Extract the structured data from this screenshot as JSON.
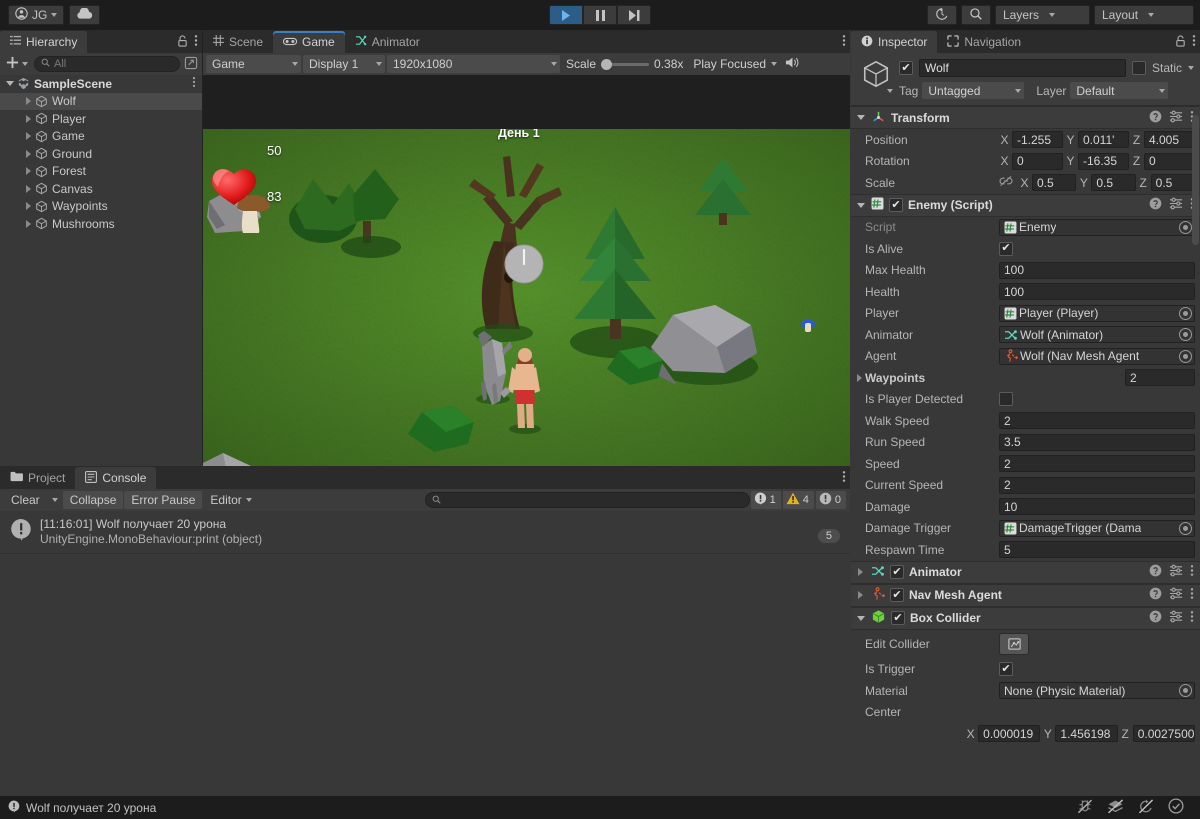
{
  "toolbar": {
    "account_label": "JG",
    "account_icon": "user-circle-icon",
    "cloud_icon": "cloud-icon",
    "play_icon": "play-icon",
    "pause_icon": "pause-icon",
    "step_icon": "step-icon",
    "history_icon": "undo-history-icon",
    "search_icon": "search-icon",
    "layers_label": "Layers",
    "layout_label": "Layout"
  },
  "hierarchy": {
    "tab_label": "Hierarchy",
    "tab_icon": "hierarchy-icon",
    "lock_icon": "lock-icon",
    "menu_icon": "kebab-menu-icon",
    "add_label": "+",
    "search_placeholder": "All",
    "search_icon": "search-icon",
    "filter_icon": "scene-filter-icon",
    "scene_name": "SampleScene",
    "items": [
      {
        "label": "Wolf",
        "selected": true
      },
      {
        "label": "Player",
        "selected": false
      },
      {
        "label": "Game",
        "selected": false
      },
      {
        "label": "Ground",
        "selected": false
      },
      {
        "label": "Forest",
        "selected": false
      },
      {
        "label": "Canvas",
        "selected": false
      },
      {
        "label": "Waypoints",
        "selected": false
      },
      {
        "label": "Mushrooms",
        "selected": false
      }
    ]
  },
  "gameview": {
    "tabs": [
      {
        "label": "Scene",
        "icon": "grid-icon",
        "active": false
      },
      {
        "label": "Game",
        "icon": "gamepad-icon",
        "active": true
      },
      {
        "label": "Animator",
        "icon": "animator-icon",
        "active": false
      }
    ],
    "menu_icon": "kebab-menu-icon",
    "target_label": "Game",
    "display_label": "Display 1",
    "resolution_label": "1920x1080",
    "scale_label": "Scale",
    "scale_value": "0.38x",
    "play_mode_label": "Play Focused",
    "mute_icon": "mute-audio-icon",
    "hud": {
      "health_icon": "heart-icon",
      "health_value": "50",
      "mushroom_icon": "mushroom-icon",
      "mushroom_value": "83",
      "day_label": "День 1",
      "clock_icon": "clock-icon"
    }
  },
  "inspector": {
    "tabs": [
      {
        "label": "Inspector",
        "icon": "info-icon",
        "active": true
      },
      {
        "label": "Navigation",
        "icon": "navigation-icon",
        "active": false
      }
    ],
    "lock_icon": "lock-icon",
    "menu_icon": "kebab-menu-icon",
    "object_icon": "gameobject-cube-icon",
    "enabled": true,
    "object_name": "Wolf",
    "static_label": "Static",
    "tag_label": "Tag",
    "tag_value": "Untagged",
    "layer_label": "Layer",
    "layer_value": "Default",
    "components": [
      {
        "name": "Transform",
        "icon": "transform-axis-icon",
        "expanded": true,
        "has_checkbox": false,
        "rows": [
          {
            "label": "Position",
            "type": "vector3",
            "x": "-1.255",
            "y": "0.011'",
            "z": "4.005"
          },
          {
            "label": "Rotation",
            "type": "vector3",
            "x": "0",
            "y": "-16.35",
            "z": "0"
          },
          {
            "label": "Scale",
            "type": "vector3",
            "x": "0.5",
            "y": "0.5",
            "z": "0.5",
            "link_icon": "broken-link-icon"
          }
        ]
      },
      {
        "name": "Enemy (Script)",
        "icon": "script-icon",
        "expanded": true,
        "has_checkbox": true,
        "checked": true,
        "rows": [
          {
            "label": "Script",
            "type": "objref",
            "value": "Enemy",
            "icon": "script-icon",
            "dim": true
          },
          {
            "label": "Is Alive",
            "type": "checkbox",
            "checked": true
          },
          {
            "label": "Max Health",
            "type": "text",
            "value": "100"
          },
          {
            "label": "Health",
            "type": "text",
            "value": "100"
          },
          {
            "label": "Player",
            "type": "objref",
            "value": "Player (Player)",
            "icon": "script-icon"
          },
          {
            "label": "Animator",
            "type": "objref",
            "value": "Wolf (Animator)",
            "icon": "animator-icon"
          },
          {
            "label": "Agent",
            "type": "objref",
            "value": "Wolf (Nav Mesh Agent",
            "icon": "navmesh-icon"
          },
          {
            "label": "Waypoints",
            "type": "array",
            "value": "2",
            "foldout": true
          },
          {
            "label": "Is Player Detected",
            "type": "checkbox",
            "checked": false
          },
          {
            "label": "Walk Speed",
            "type": "text",
            "value": "2"
          },
          {
            "label": "Run Speed",
            "type": "text",
            "value": "3.5"
          },
          {
            "label": "Speed",
            "type": "text",
            "value": "2"
          },
          {
            "label": "Current Speed",
            "type": "text",
            "value": "2"
          },
          {
            "label": "Damage",
            "type": "text",
            "value": "10"
          },
          {
            "label": "Damage Trigger",
            "type": "objref",
            "value": "DamageTrigger (Dama",
            "icon": "script-icon"
          },
          {
            "label": "Respawn Time",
            "type": "text",
            "value": "5"
          }
        ]
      },
      {
        "name": "Animator",
        "icon": "animator-icon",
        "expanded": false,
        "has_checkbox": true,
        "checked": true,
        "rows": []
      },
      {
        "name": "Nav Mesh Agent",
        "icon": "navmesh-icon",
        "expanded": false,
        "has_checkbox": true,
        "checked": true,
        "rows": []
      },
      {
        "name": "Box Collider",
        "icon": "box-collider-icon",
        "expanded": true,
        "has_checkbox": true,
        "checked": true,
        "rows": [
          {
            "label": "Edit Collider",
            "type": "button",
            "icon": "edit-collider-icon"
          },
          {
            "label": "Is Trigger",
            "type": "checkbox",
            "checked": true
          },
          {
            "label": "Material",
            "type": "objref",
            "value": "None (Physic Material)"
          },
          {
            "label": "Center",
            "type": "label"
          },
          {
            "label": "",
            "type": "vector3",
            "x": "0.000019",
            "y": "1.456198",
            "z": "0.0027500"
          }
        ]
      }
    ]
  },
  "console": {
    "tabs": [
      {
        "label": "Project",
        "icon": "folder-icon",
        "active": false
      },
      {
        "label": "Console",
        "icon": "console-icon",
        "active": true
      }
    ],
    "menu_icon": "kebab-menu-icon",
    "clear_label": "Clear",
    "collapse_label": "Collapse",
    "error_pause_label": "Error Pause",
    "editor_label": "Editor",
    "search_icon": "search-icon",
    "search_placeholder": "",
    "counts": {
      "log": "1",
      "warning": "4",
      "error": "0"
    },
    "entries": [
      {
        "icon": "log-info-icon",
        "line1": "[11:16:01] Wolf получает 20 урона",
        "line2": "UnityEngine.MonoBehaviour:print (object)",
        "count": "5"
      }
    ]
  },
  "statusbar": {
    "icon": "log-info-icon",
    "message": "Wolf получает 20 урона",
    "right_icons": [
      "bug-off-icon",
      "layers-off-icon",
      "refresh-off-icon",
      "check-circle-icon"
    ]
  }
}
